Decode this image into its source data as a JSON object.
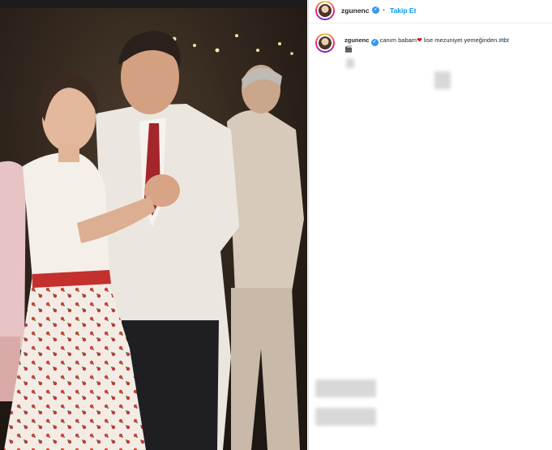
{
  "header": {
    "username": "zgunenc",
    "separator": "•",
    "follow_label": "Takip Et"
  },
  "caption": {
    "username": "zgunenc",
    "text_before": "canım babam",
    "heart": "❤",
    "text_after": "lise mezuniyet yemeğinden.",
    "hashtag": "#tbt",
    "emoji": "🎬"
  },
  "icons": {
    "verified": "✓"
  }
}
